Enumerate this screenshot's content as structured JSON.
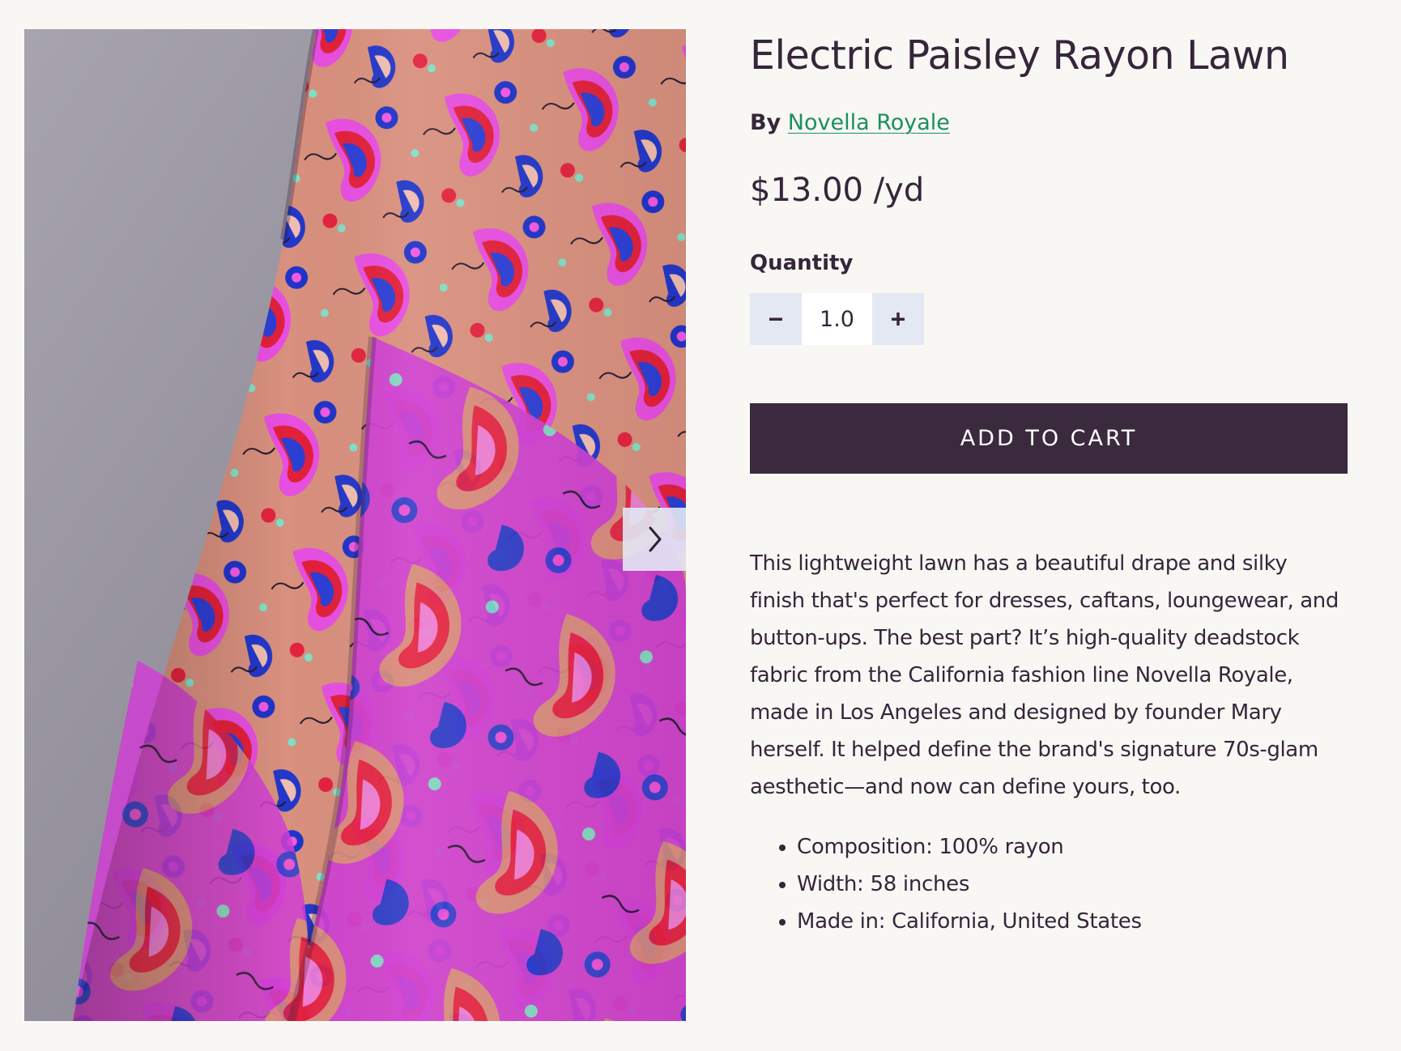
{
  "product": {
    "title": "Electric Paisley Rayon Lawn",
    "by_label": "By",
    "brand": "Novella Royale",
    "price": "$13.00 /yd",
    "quantity_label": "Quantity",
    "quantity_value": "1.0",
    "add_to_cart_label": "ADD TO CART",
    "description": "This lightweight lawn has a beautiful drape and silky finish that's perfect for dresses, caftans, loungewear, and button-ups. The best part? It’s high-quality deadstock fabric from the California fashion line Novella Royale, made in Los Angeles and designed by founder Mary herself. It helped define the brand's signature 70s-glam aesthetic—and now can define yours, too.",
    "specs": [
      "Composition: 100% rayon",
      "Width: 58 inches",
      "Made in: California, United States"
    ]
  },
  "gallery": {
    "image": "paisley-fabric-photo",
    "next_icon": "chevron-right-icon"
  },
  "colors": {
    "background": "#f8f7f4",
    "text": "#35263a",
    "link": "#1b8f5f",
    "button": "#3b2a3e",
    "stepper": "#e3e8f2"
  }
}
